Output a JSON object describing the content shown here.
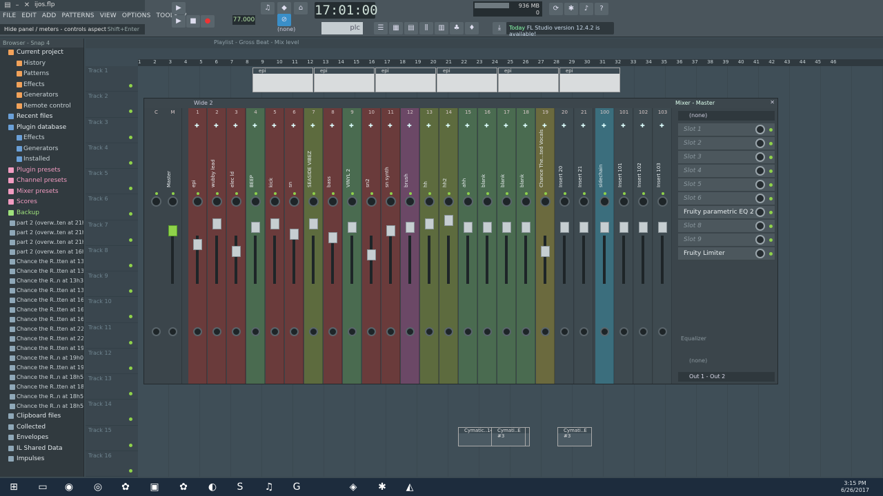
{
  "window": {
    "project_file": "ijos.flp"
  },
  "menu": [
    "FILE",
    "EDIT",
    "ADD",
    "PATTERNS",
    "VIEW",
    "OPTIONS",
    "TOOLS",
    "?"
  ],
  "hint": {
    "text": "Hide panel / meters - controls aspect",
    "shortcut": "Shift+Enter"
  },
  "transport": {
    "time": "17:01:00",
    "tempo": "77.000",
    "pattern": "(none)",
    "snap": "plc"
  },
  "cpu": {
    "memory": "936 MB",
    "poly": "10",
    "cpu_val": "0"
  },
  "news": {
    "prefix": "Today",
    "message": "FL Studio version 12.4.2 is available!"
  },
  "browser": {
    "header": "Browser - Snap 4",
    "items": [
      {
        "label": "Current project",
        "level": 0,
        "color": "#f2a25a"
      },
      {
        "label": "History",
        "level": 1,
        "color": "#f2a25a"
      },
      {
        "label": "Patterns",
        "level": 1,
        "color": "#f2a25a"
      },
      {
        "label": "Effects",
        "level": 1,
        "color": "#f2a25a"
      },
      {
        "label": "Generators",
        "level": 1,
        "color": "#f2a25a"
      },
      {
        "label": "Remote control",
        "level": 1,
        "color": "#f2a25a"
      },
      {
        "label": "Recent files",
        "level": 0,
        "color": "#6aa0d8"
      },
      {
        "label": "Plugin database",
        "level": 0,
        "color": "#6aa0d8"
      },
      {
        "label": "Effects",
        "level": 1,
        "color": "#6aa0d8"
      },
      {
        "label": "Generators",
        "level": 1,
        "color": "#6aa0d8"
      },
      {
        "label": "Installed",
        "level": 1,
        "color": "#6aa0d8"
      },
      {
        "label": "Plugin presets",
        "level": 0,
        "color": "#f19bc0",
        "style": "pink"
      },
      {
        "label": "Channel presets",
        "level": 0,
        "color": "#f19bc0",
        "style": "pink"
      },
      {
        "label": "Mixer presets",
        "level": 0,
        "color": "#f19bc0",
        "style": "pink"
      },
      {
        "label": "Scores",
        "level": 0,
        "color": "#f19bc0",
        "style": "pink"
      },
      {
        "label": "Backup",
        "level": 0,
        "color": "#9fe27c",
        "style": "green"
      }
    ],
    "files": [
      "part 2 (overw..ten at 21h27)",
      "part 2 (overw..ten at 21h17)",
      "part 2 (overw..ten at 21h16)",
      "part 2 (overw..ten at 16h09)",
      "Chance the R..tten at 13h41)",
      "Chance the R..tten at 13h40)",
      "Chance the R..n at 13h39)_2",
      "Chance the R..tten at 13h39)",
      "Chance the R..tten at 16h32)",
      "Chance the R..tten at 16h25)",
      "Chance the R..tten at 16h22)",
      "Chance the R..tten at 22h56)",
      "Chance the R..tten at 22h55)",
      "Chance the R..tten at 19h01)",
      "Chance the R..n at 19h00)_2",
      "Chance the R..tten at 19h00)",
      "Chance the R..n at 18h59)_2",
      "Chance the R..tten at 18h59)",
      "Chance the R..n at 18h58)_4",
      "Chance the R..n at 18h58)_3"
    ],
    "bottom": [
      "Clipboard files",
      "Collected",
      "Envelopes",
      "IL Shared Data",
      "Impulses"
    ]
  },
  "playlist": {
    "title": "Playlist - Gross Beat - Mix level",
    "tracks": [
      "Track 1",
      "Track 2",
      "Track 3",
      "Track 4",
      "Track 5",
      "Track 6",
      "Track 7",
      "Track 8",
      "Track 9",
      "Track 10",
      "Track 11",
      "Track 12",
      "Track 13",
      "Track 14",
      "Track 15",
      "Track 16"
    ],
    "ruler": [
      "1",
      "2",
      "3",
      "4",
      "5",
      "6",
      "7",
      "8",
      "9",
      "10",
      "11",
      "12",
      "13",
      "14",
      "15",
      "16",
      "17",
      "18",
      "19",
      "20",
      "21",
      "22",
      "23",
      "24",
      "25",
      "26",
      "27",
      "28",
      "29",
      "30",
      "31",
      "32",
      "33",
      "34",
      "35",
      "36",
      "37",
      "38",
      "39",
      "40",
      "41",
      "42",
      "43",
      "44",
      "45",
      "46"
    ],
    "clips": [
      {
        "label": "epi"
      },
      {
        "label": "epi"
      },
      {
        "label": "epi"
      },
      {
        "label": "epi"
      },
      {
        "label": "epi"
      },
      {
        "label": "epi"
      }
    ],
    "audio_clips": [
      "Cymatic..14 - E",
      "Cymati..E #3",
      "Cymati..E #3"
    ]
  },
  "mixer": {
    "preset": "Wide 2",
    "title": "Mixer - Master",
    "strips": [
      {
        "num": "C",
        "name": "",
        "color": "#3b454b"
      },
      {
        "num": "M",
        "name": "Master",
        "color": "#3b454b"
      },
      {
        "num": "1",
        "name": "epi",
        "color": "#6a3b3b"
      },
      {
        "num": "2",
        "name": "wubby lead",
        "color": "#6a3b3b"
      },
      {
        "num": "3",
        "name": "elec ld",
        "color": "#6a3b3b"
      },
      {
        "num": "4",
        "name": "BEEP",
        "color": "#4a6b50"
      },
      {
        "num": "5",
        "name": "kick",
        "color": "#6a3b3b"
      },
      {
        "num": "6",
        "name": "sn",
        "color": "#6a3b3b"
      },
      {
        "num": "7",
        "name": "SEASIDE VIBEZ",
        "color": "#5d6b3e"
      },
      {
        "num": "8",
        "name": "bass",
        "color": "#6a3b3b"
      },
      {
        "num": "9",
        "name": "VINYL 2",
        "color": "#4a6b50"
      },
      {
        "num": "10",
        "name": "sn2",
        "color": "#6a3b3b"
      },
      {
        "num": "11",
        "name": "sn synth",
        "color": "#6a3b3b"
      },
      {
        "num": "12",
        "name": "brush",
        "color": "#6b4866"
      },
      {
        "num": "13",
        "name": "hh",
        "color": "#5d6b3e"
      },
      {
        "num": "14",
        "name": "hh2",
        "color": "#5d6b3e"
      },
      {
        "num": "15",
        "name": "ahh",
        "color": "#4a6b50"
      },
      {
        "num": "16",
        "name": "blank",
        "color": "#4a6b50"
      },
      {
        "num": "17",
        "name": "blank",
        "color": "#4a6b50"
      },
      {
        "num": "18",
        "name": "blank",
        "color": "#4a6b50"
      },
      {
        "num": "19",
        "name": "Chance The...ted Vocals",
        "color": "#6b6a3e"
      },
      {
        "num": "20",
        "name": "Insert 20",
        "color": "#3e4a50"
      },
      {
        "num": "21",
        "name": "Insert 21",
        "color": "#3e4a50"
      },
      {
        "num": "100",
        "name": "sidechain",
        "color": "#3b6e7d"
      },
      {
        "num": "101",
        "name": "Insert 101",
        "color": "#3e4a50"
      },
      {
        "num": "102",
        "name": "Insert 102",
        "color": "#3e4a50"
      },
      {
        "num": "103",
        "name": "Insert 103",
        "color": "#3e4a50"
      }
    ],
    "input": "(none)",
    "slots": [
      {
        "label": "Slot 1",
        "on": false
      },
      {
        "label": "Slot 2",
        "on": false
      },
      {
        "label": "Slot 3",
        "on": false
      },
      {
        "label": "Slot 4",
        "on": false
      },
      {
        "label": "Slot 5",
        "on": false
      },
      {
        "label": "Slot 6",
        "on": false
      },
      {
        "label": "Fruity parametric EQ 2",
        "on": true
      },
      {
        "label": "Slot 8",
        "on": false
      },
      {
        "label": "Slot 9",
        "on": false
      },
      {
        "label": "Fruity Limiter",
        "on": true
      }
    ],
    "eq_label": "Equalizer",
    "send_none": "(none)",
    "output": "Out 1 - Out 2"
  },
  "taskbar": {
    "time": "3:15 PM",
    "date": "6/26/2017"
  }
}
